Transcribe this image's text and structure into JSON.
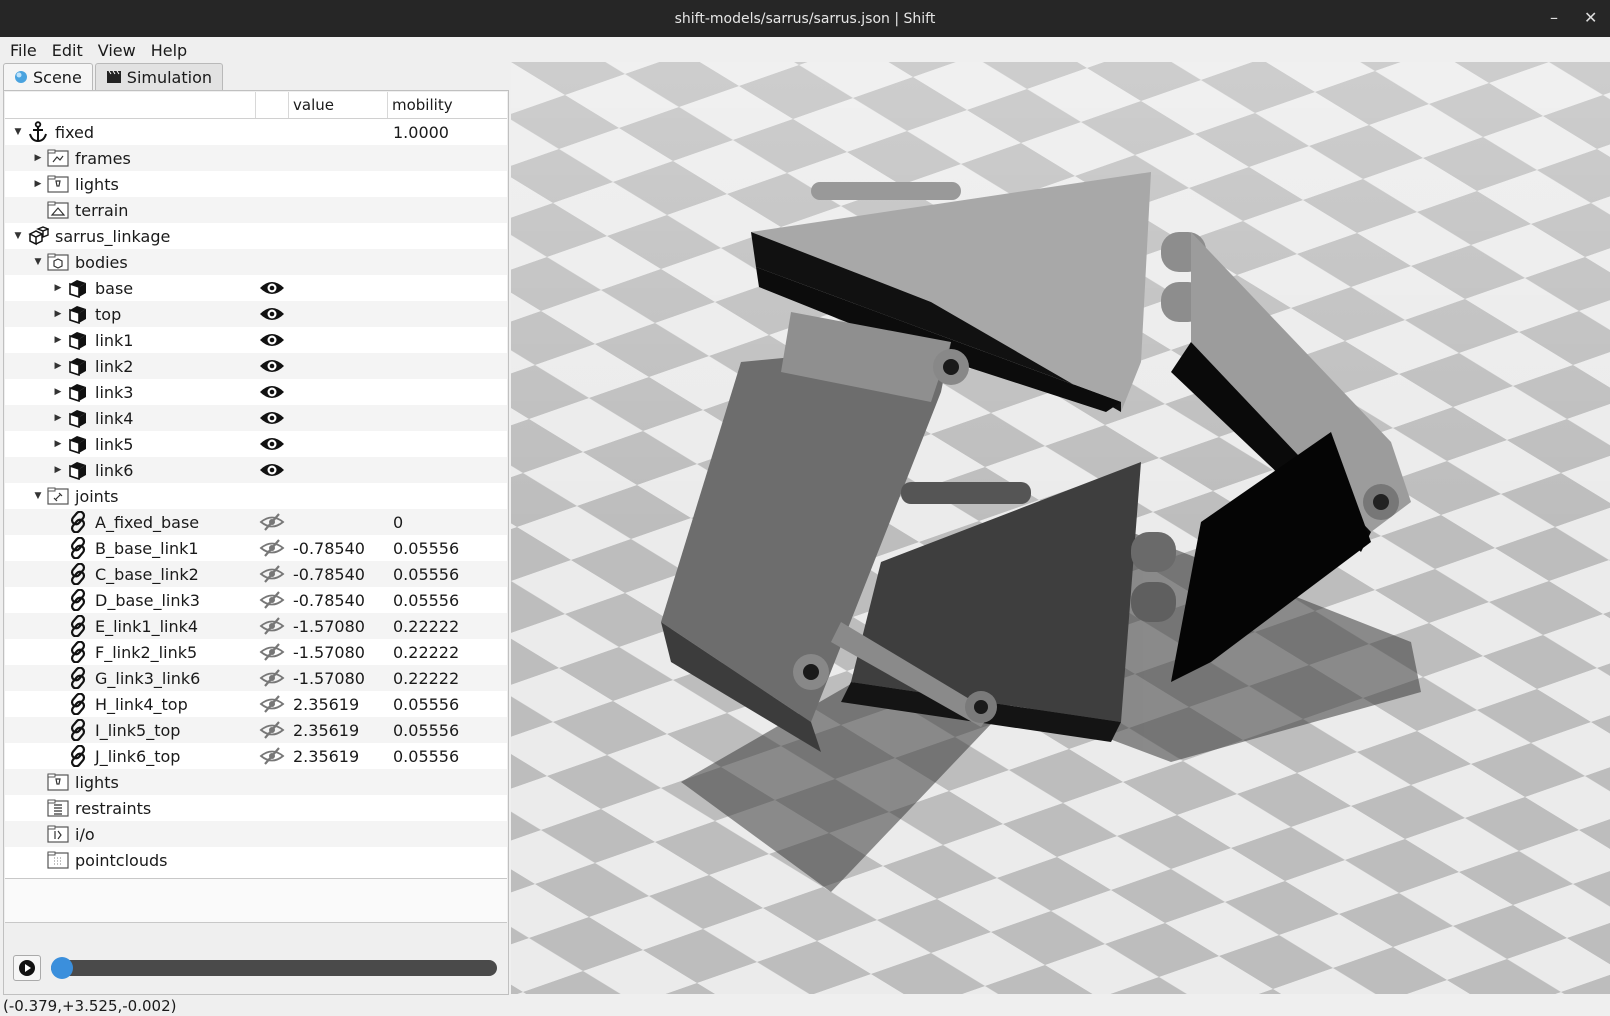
{
  "window": {
    "title": "shift-models/sarrus/sarrus.json | Shift",
    "minimize": "–",
    "close": "✕"
  },
  "menu": [
    "File",
    "Edit",
    "View",
    "Help"
  ],
  "tabs": [
    {
      "label": "Scene",
      "active": true
    },
    {
      "label": "Simulation",
      "active": false
    }
  ],
  "tree": {
    "columns": [
      "",
      "",
      "value",
      "mobility"
    ],
    "rows": [
      {
        "label": "fixed",
        "depth": 0,
        "icon": "anchor-icon",
        "expand": "down",
        "mobility": "1.0000"
      },
      {
        "label": "frames",
        "depth": 1,
        "icon": "frames-folder-icon",
        "expand": "right"
      },
      {
        "label": "lights",
        "depth": 1,
        "icon": "lights-folder-icon",
        "expand": "right"
      },
      {
        "label": "terrain",
        "depth": 1,
        "icon": "terrain-folder-icon",
        "expand": "none"
      },
      {
        "label": "sarrus_linkage",
        "depth": 0,
        "icon": "model-icon",
        "expand": "down"
      },
      {
        "label": "bodies",
        "depth": 1,
        "icon": "bodies-folder-icon",
        "expand": "down"
      },
      {
        "label": "base",
        "depth": 2,
        "icon": "body-cube-icon",
        "expand": "right",
        "eye": "visible"
      },
      {
        "label": "top",
        "depth": 2,
        "icon": "body-cube-icon",
        "expand": "right",
        "eye": "visible"
      },
      {
        "label": "link1",
        "depth": 2,
        "icon": "body-cube-icon",
        "expand": "right",
        "eye": "visible"
      },
      {
        "label": "link2",
        "depth": 2,
        "icon": "body-cube-icon",
        "expand": "right",
        "eye": "visible"
      },
      {
        "label": "link3",
        "depth": 2,
        "icon": "body-cube-icon",
        "expand": "right",
        "eye": "visible"
      },
      {
        "label": "link4",
        "depth": 2,
        "icon": "body-cube-icon",
        "expand": "right",
        "eye": "visible"
      },
      {
        "label": "link5",
        "depth": 2,
        "icon": "body-cube-icon",
        "expand": "right",
        "eye": "visible"
      },
      {
        "label": "link6",
        "depth": 2,
        "icon": "body-cube-icon",
        "expand": "right",
        "eye": "visible"
      },
      {
        "label": "joints",
        "depth": 1,
        "icon": "joints-folder-icon",
        "expand": "down"
      },
      {
        "label": "A_fixed_base",
        "depth": 2,
        "icon": "joint-link-icon",
        "expand": "none",
        "eye": "hidden",
        "value": "",
        "mobility": "0"
      },
      {
        "label": "B_base_link1",
        "depth": 2,
        "icon": "joint-link-icon",
        "expand": "none",
        "eye": "hidden",
        "value": "-0.78540",
        "mobility": "0.05556"
      },
      {
        "label": "C_base_link2",
        "depth": 2,
        "icon": "joint-link-icon",
        "expand": "none",
        "eye": "hidden",
        "value": "-0.78540",
        "mobility": "0.05556"
      },
      {
        "label": "D_base_link3",
        "depth": 2,
        "icon": "joint-link-icon",
        "expand": "none",
        "eye": "hidden",
        "value": "-0.78540",
        "mobility": "0.05556"
      },
      {
        "label": "E_link1_link4",
        "depth": 2,
        "icon": "joint-link-icon",
        "expand": "none",
        "eye": "hidden",
        "value": "-1.57080",
        "mobility": "0.22222"
      },
      {
        "label": "F_link2_link5",
        "depth": 2,
        "icon": "joint-link-icon",
        "expand": "none",
        "eye": "hidden",
        "value": "-1.57080",
        "mobility": "0.22222"
      },
      {
        "label": "G_link3_link6",
        "depth": 2,
        "icon": "joint-link-icon",
        "expand": "none",
        "eye": "hidden",
        "value": "-1.57080",
        "mobility": "0.22222"
      },
      {
        "label": "H_link4_top",
        "depth": 2,
        "icon": "joint-link-icon",
        "expand": "none",
        "eye": "hidden",
        "value": "2.35619",
        "mobility": "0.05556"
      },
      {
        "label": "I_link5_top",
        "depth": 2,
        "icon": "joint-link-icon",
        "expand": "none",
        "eye": "hidden",
        "value": "2.35619",
        "mobility": "0.05556"
      },
      {
        "label": "J_link6_top",
        "depth": 2,
        "icon": "joint-link-icon",
        "expand": "none",
        "eye": "hidden",
        "value": "2.35619",
        "mobility": "0.05556"
      },
      {
        "label": "lights",
        "depth": 1,
        "icon": "lights-folder-icon",
        "expand": "none"
      },
      {
        "label": "restraints",
        "depth": 1,
        "icon": "restraints-folder-icon",
        "expand": "none"
      },
      {
        "label": "i/o",
        "depth": 1,
        "icon": "io-folder-icon",
        "expand": "none"
      },
      {
        "label": "pointclouds",
        "depth": 1,
        "icon": "pointclouds-folder-icon",
        "expand": "none"
      }
    ]
  },
  "player": {
    "play_icon": "play-icon",
    "progress": 0.0
  },
  "status": {
    "coords": "(-0.379,+3.525,-0.002)"
  },
  "colors": {
    "slider_handle": "#3b8fdc",
    "slider_track": "#4a4a4a",
    "titlebar": "#262626"
  }
}
